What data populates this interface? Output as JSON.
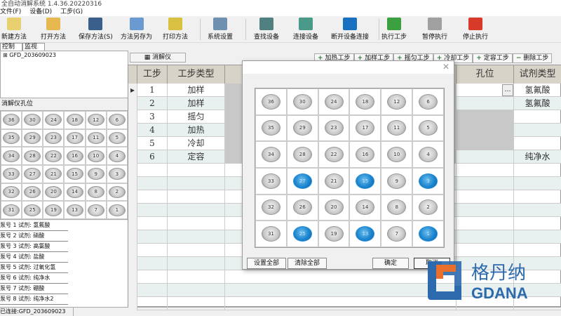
{
  "window": {
    "title": "全自动消解系统 1.4.36.20220316"
  },
  "menu": [
    "文件(F)",
    "设备(D)",
    "工步(G)"
  ],
  "toolbar": [
    {
      "label": "新建方法",
      "icon": "new-icon",
      "color": "#e8d070"
    },
    {
      "label": "打开方法",
      "icon": "open-folder-icon",
      "color": "#e8b850"
    },
    {
      "label": "保存方法(S)",
      "icon": "save-icon",
      "color": "#3a5f8a"
    },
    {
      "label": "方法另存为",
      "icon": "save-as-icon",
      "color": "#6a9ad0"
    },
    {
      "label": "打印方法",
      "icon": "print-icon",
      "color": "#d8c040"
    },
    {
      "label": "系统设置",
      "icon": "tools-icon",
      "color": "#7090b0"
    },
    {
      "label": "查找设备",
      "icon": "search-device-icon",
      "color": "#508080"
    },
    {
      "label": "连接设备",
      "icon": "connect-icon",
      "color": "#4a9a8a"
    },
    {
      "label": "断开设备连接",
      "icon": "bluetooth-icon",
      "color": "#1a70c0"
    },
    {
      "label": "执行工步",
      "icon": "play-icon",
      "color": "#3aa040"
    },
    {
      "label": "暂停执行",
      "icon": "pause-icon",
      "color": "#a0a0a0"
    },
    {
      "label": "停止执行",
      "icon": "stop-icon",
      "color": "#d83a2a"
    }
  ],
  "left_tabs": [
    "控制",
    "监视"
  ],
  "tree": {
    "node": "GFD_203609023"
  },
  "holes": {
    "title": "消解仪孔位",
    "grid": [
      [
        36,
        30,
        24,
        18,
        12,
        6
      ],
      [
        35,
        29,
        23,
        17,
        11,
        5
      ],
      [
        34,
        28,
        22,
        16,
        10,
        4
      ],
      [
        33,
        27,
        21,
        15,
        9,
        3
      ],
      [
        32,
        26,
        20,
        14,
        8,
        2
      ],
      [
        31,
        25,
        19,
        13,
        7,
        1
      ]
    ]
  },
  "pumps": [
    "泵号 1 试剂: 氢氟酸",
    "泵号 2 试剂: 硝酸",
    "泵号 3 试剂: 高氯酸",
    "泵号 4 试剂: 盐酸",
    "泵号 5 试剂: 过氧化氢",
    "泵号 6 试剂: 纯净水",
    "泵号 7 试剂: 硼酸",
    "泵号 8 试剂: 纯净水2"
  ],
  "status": {
    "connection": "已连接:GFD_203609023"
  },
  "main_tab": "消解仪",
  "step_buttons": [
    "加热工步",
    "加样工步",
    "摇匀工步",
    "冷却工步",
    "定容工步",
    "删除工步"
  ],
  "table": {
    "headers": [
      "工步",
      "工步类型",
      "℃",
      "孔位",
      "试剂类型"
    ],
    "rows": [
      [
        "1",
        "加样",
        "",
        "",
        "氢氟酸"
      ],
      [
        "2",
        "加样",
        "",
        "",
        "氢氟酸"
      ],
      [
        "3",
        "摇匀",
        "",
        "",
        ""
      ],
      [
        "4",
        "加热",
        "(",
        "",
        ""
      ],
      [
        "5",
        "冷却",
        "",
        "",
        ""
      ],
      [
        "6",
        "定容",
        "",
        "",
        "纯净水"
      ]
    ]
  },
  "dialog": {
    "selected": [
      27,
      15,
      3,
      25,
      13,
      1
    ],
    "set_all": "设置全部",
    "clear_all": "清除全部",
    "ok": "确定",
    "cancel": "取消"
  },
  "logo": {
    "cn": "格丹纳",
    "en": "GDANA",
    "blue": "#2d6aad",
    "orange": "#e8702a"
  }
}
